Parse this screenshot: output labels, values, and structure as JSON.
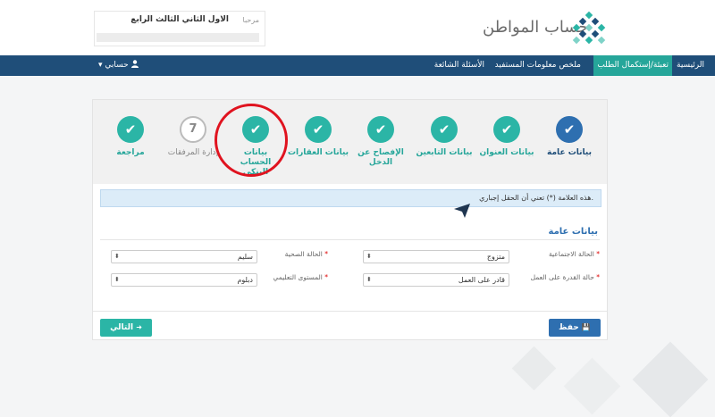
{
  "header": {
    "greeting": "مرحبا",
    "user_name": "الاول الثاني الثالث الرابع",
    "logo_text": "حساب المواطن"
  },
  "nav": {
    "items": [
      {
        "label": "الرئيسية"
      },
      {
        "label": "تعبئة/إستكمال الطلب",
        "active": true
      },
      {
        "label": "ملخص معلومات المستفيد"
      },
      {
        "label": "الأسئلة الشائعة"
      }
    ],
    "account_label": "حسابي",
    "account_caret": "▾",
    "user_icon": "user-icon"
  },
  "steps": [
    {
      "label": "بيانات عامة",
      "state": "current",
      "icon": "✔"
    },
    {
      "label": "بيانات العنوان",
      "state": "done",
      "icon": "✔"
    },
    {
      "label": "بيانات التابعين",
      "state": "done",
      "icon": "✔"
    },
    {
      "label": "الإفصاح عن الدخل",
      "state": "done",
      "icon": "✔"
    },
    {
      "label": "بيانات العقارات",
      "state": "done",
      "icon": "✔"
    },
    {
      "label": "بيانات الحساب البنكي",
      "state": "done",
      "icon": "✔"
    },
    {
      "label": "إدارة المرفقات",
      "state": "pending",
      "icon": "7"
    },
    {
      "label": "مراجعة",
      "state": "done",
      "icon": "✔"
    }
  ],
  "info_message": "هذه العلامة (*) تعني أن الحقل إجباري.",
  "section_title": "بيانات عامة",
  "form": {
    "marital_label": "الحالة الاجتماعية",
    "marital_value": "متزوج",
    "health_label": "الحالة الصحية",
    "health_value": "سليم",
    "work_label": "حالة القدرة على العمل",
    "work_value": "قادر على العمل",
    "edu_label": "المستوى التعليمي",
    "edu_value": "دبلوم",
    "required_mark": "*",
    "select_arrow": "⬍"
  },
  "buttons": {
    "next_label": "التالي",
    "next_icon": "➜",
    "save_label": "حفظ",
    "save_icon": "💾"
  },
  "colors": {
    "nav_bg": "#1f4e79",
    "accent_teal": "#2bb5a6",
    "accent_blue": "#2e6fb0",
    "highlight_red": "#e0131f"
  }
}
